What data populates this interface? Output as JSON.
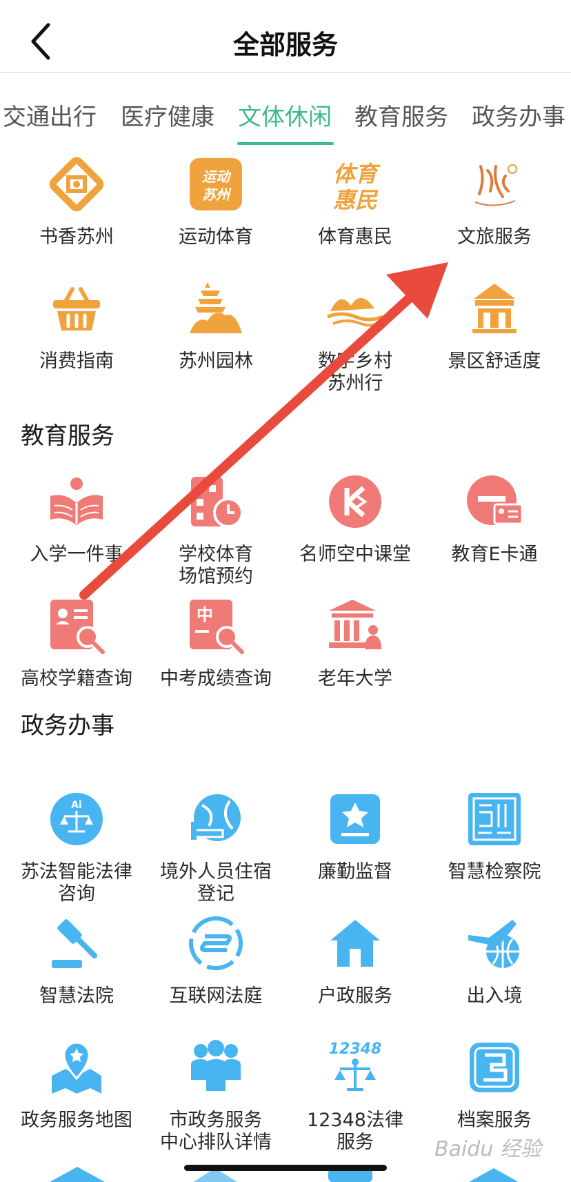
{
  "header": {
    "title": "全部服务"
  },
  "tabs": [
    {
      "label": "交通出行",
      "active": false
    },
    {
      "label": "医疗健康",
      "active": false
    },
    {
      "label": "文体休闲",
      "active": true
    },
    {
      "label": "教育服务",
      "active": false
    },
    {
      "label": "政务办事",
      "active": false
    }
  ],
  "colors": {
    "accent": "#3dbb8c",
    "orange": "#f0a23c",
    "coral": "#ef7a76",
    "blue": "#48b4f0",
    "arrow": "#e84a3b"
  },
  "leisure": {
    "items": [
      {
        "label": "书香苏州",
        "icon": "book-emblem-icon"
      },
      {
        "label": "运动体育",
        "icon": "sport-suzhou-icon"
      },
      {
        "label": "体育惠民",
        "icon": "sports-benefit-icon"
      },
      {
        "label": "文旅服务",
        "icon": "calligraphy-icon"
      },
      {
        "label": "消费指南",
        "icon": "basket-icon"
      },
      {
        "label": "苏州园林",
        "icon": "pagoda-icon"
      },
      {
        "label": "数字乡村\n苏州行",
        "icon": "landscape-icon"
      },
      {
        "label": "景区舒适度",
        "icon": "pavilion-icon"
      }
    ]
  },
  "education": {
    "title": "教育服务",
    "items": [
      {
        "label": "入学一件事",
        "icon": "open-book-icon"
      },
      {
        "label": "学校体育\n场馆预约",
        "icon": "building-clock-icon"
      },
      {
        "label": "名师空中课堂",
        "icon": "k-logo-icon"
      },
      {
        "label": "教育E卡通",
        "icon": "e-card-icon"
      },
      {
        "label": "高校学籍查询",
        "icon": "id-search-icon"
      },
      {
        "label": "中考成绩查询",
        "icon": "score-search-icon"
      },
      {
        "label": "老年大学",
        "icon": "university-icon"
      }
    ]
  },
  "government": {
    "title": "政务办事",
    "items": [
      {
        "label": "苏法智能法律\n咨询",
        "icon": "ai-scale-icon"
      },
      {
        "label": "境外人员住宿\n登记",
        "icon": "globe-bed-icon"
      },
      {
        "label": "廉勤监督",
        "icon": "badge-icon"
      },
      {
        "label": "智慧检察院",
        "icon": "seal-icon"
      },
      {
        "label": "智慧法院",
        "icon": "gavel-icon"
      },
      {
        "label": "互联网法庭",
        "icon": "network-court-icon"
      },
      {
        "label": "户政服务",
        "icon": "house-icon"
      },
      {
        "label": "出入境",
        "icon": "plane-globe-icon"
      },
      {
        "label": "政务服务地图",
        "icon": "map-pin-icon"
      },
      {
        "label": "市政务服务\n中心排队详情",
        "icon": "people-queue-icon"
      },
      {
        "label": "12348法律\n服务",
        "icon": "law-12348-icon"
      },
      {
        "label": "档案服务",
        "icon": "archive-icon"
      }
    ]
  },
  "watermark": "Baidu 经验"
}
